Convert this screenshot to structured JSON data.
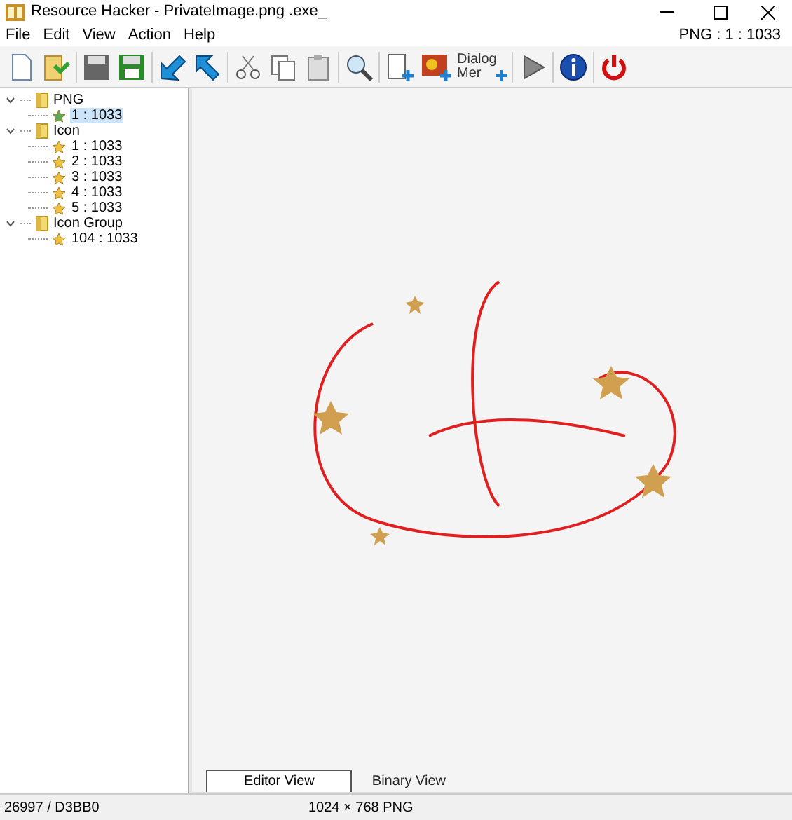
{
  "window": {
    "title": "Resource Hacker - PrivateImage.png .exe_"
  },
  "menu": [
    "File",
    "Edit",
    "View",
    "Action",
    "Help"
  ],
  "resource_path": "PNG : 1 : 1033",
  "toolbar": {
    "dialog_button": [
      "Dialog",
      "Mer"
    ]
  },
  "tree": [
    {
      "label": "PNG",
      "expanded": true,
      "children": [
        {
          "label": "1 : 1033",
          "selected": true
        }
      ]
    },
    {
      "label": "Icon",
      "expanded": true,
      "children": [
        {
          "label": "1 : 1033",
          "selected": false
        },
        {
          "label": "2 : 1033",
          "selected": false
        },
        {
          "label": "3 : 1033",
          "selected": false
        },
        {
          "label": "4 : 1033",
          "selected": false
        },
        {
          "label": "5 : 1033",
          "selected": false
        }
      ]
    },
    {
      "label": "Icon Group",
      "expanded": true,
      "children": [
        {
          "label": "104 : 1033",
          "selected": false
        }
      ]
    }
  ],
  "tabs": [
    {
      "label": "Editor View",
      "selected": true
    },
    {
      "label": "Binary View",
      "selected": false
    }
  ],
  "status_bar": [
    "26997 / D3BB0",
    "1024 × 768  PNG"
  ]
}
